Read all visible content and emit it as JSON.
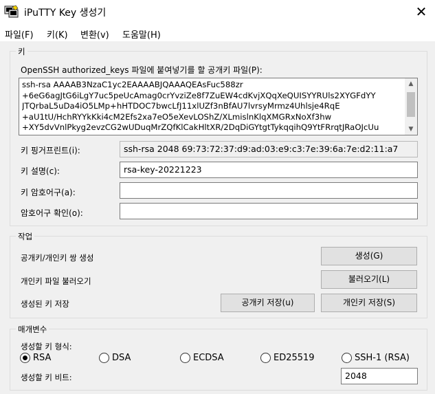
{
  "window": {
    "title": "iPuTTY Key 생성기",
    "close_glyph": "✕"
  },
  "menu": [
    "파일(F)",
    "키(K)",
    "변환(v)",
    "도움말(H)"
  ],
  "key_group": {
    "title": "키",
    "pubkey_label": "OpenSSH authorized_keys 파일에 붙여넣기를 할 공개키 파일(P):",
    "pubkey_lines": [
      "ssh-rsa AAAAB3NzaC1yc2EAAAABJQAAAQEAsFuc588zr",
      "+6eG6agJtG6iLgY7uc5peUcAmag0crYvziZe8f7ZuEW4cdKvjXQqXeQUISYYRUls2XYGFdYY",
      "JTQrbaL5uDa4iO5LMp+hHTDOC7bwcLfJ11xlUZf3nBfAU7lvrsyMrmz4Uhlsje4RqE",
      "+aU1tU/HchRYYkKki4cM2Efs2xa7eO5eXevLOShZ/XLmislnKlqXMGRxNoXf3hw",
      "+XY5dvVnlPkyg2evzCG2wUDuqMrZQfKlCakHltXR/2DqDiGYtgtTykqqihQ9YtFRrqtJRaOJcUu"
    ],
    "fingerprint_label": "키 핑거프린트(i):",
    "fingerprint_value": "ssh-rsa 2048 69:73:72:37:d9:ad:03:e9:c3:7e:39:6a:7e:d2:11:a7",
    "comment_label": "키 설명(c):",
    "comment_value": "rsa-key-20221223",
    "passphrase_label": "키 암호어구(a):",
    "passphrase_value": "",
    "confirm_label": "암호어구 확인(o):",
    "confirm_value": ""
  },
  "actions_group": {
    "title": "작업",
    "generate_label": "공개키/개인키 쌍 생성",
    "generate_button": "생성(G)",
    "load_label": "개인키 파일 불러오기",
    "load_button": "불러오기(L)",
    "save_label": "생성된 키 저장",
    "save_public_button": "공개키 저장(u)",
    "save_private_button": "개인키 저장(S)"
  },
  "params_group": {
    "title": "매개변수",
    "type_label": "생성할 키 형식:",
    "types": [
      {
        "label": "RSA",
        "checked": true
      },
      {
        "label": "DSA",
        "checked": false
      },
      {
        "label": "ECDSA",
        "checked": false
      },
      {
        "label": "ED25519",
        "checked": false
      },
      {
        "label": "SSH-1 (RSA)",
        "checked": false
      }
    ],
    "bits_label": "생성할 키 비트:",
    "bits_value": "2048"
  },
  "colors": {
    "dialog_bg": "#f0f0f0",
    "button_bg": "#e1e1e1",
    "border": "#7a7a7a"
  }
}
